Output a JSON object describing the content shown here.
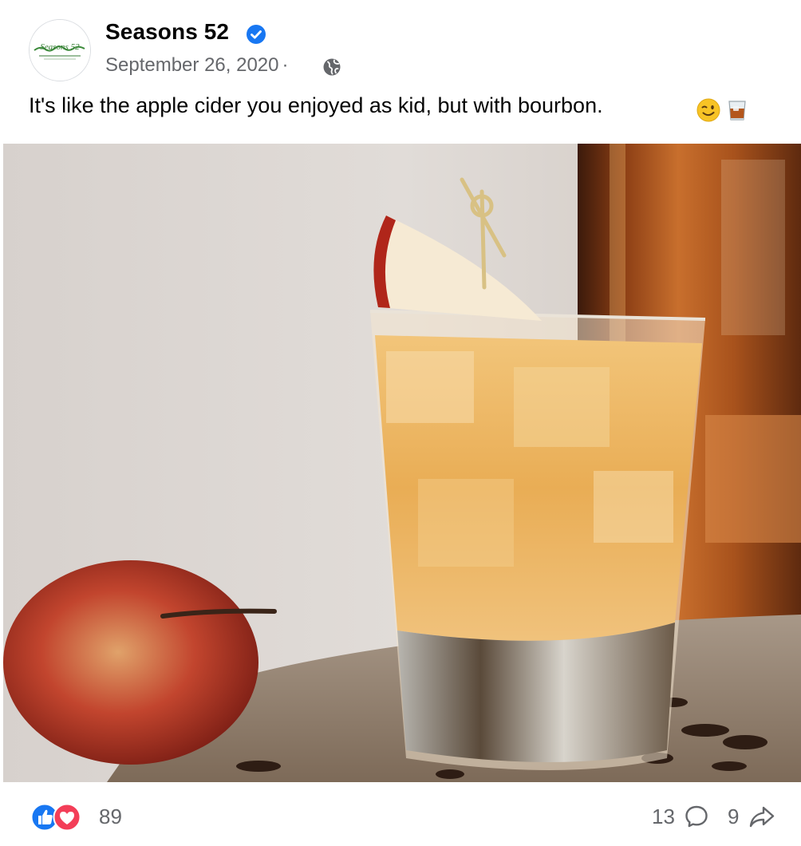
{
  "post": {
    "page_name": "Seasons 52",
    "avatar_logo_text": "Seasons 52",
    "date": "September 26, 2020",
    "separator": "·",
    "audience_icon": "globe-icon",
    "verified_icon": "verified-badge-icon",
    "caption": "It's like the apple cider you enjoyed as kid, but with bourbon.",
    "caption_emojis": [
      "winking-face-emoji",
      "tumbler-glass-emoji"
    ],
    "image_subject": "apple-cider-bourbon-cocktail-photo"
  },
  "footer": {
    "reaction_icons": [
      "like-icon",
      "love-icon"
    ],
    "reaction_count": "89",
    "comment_count": "13",
    "comment_icon": "comment-icon",
    "share_count": "9",
    "share_icon": "share-icon"
  },
  "colors": {
    "facebook_blue": "#1877f2",
    "love_red": "#f33e58",
    "secondary_text": "#65676b",
    "primary_text": "#050505"
  }
}
